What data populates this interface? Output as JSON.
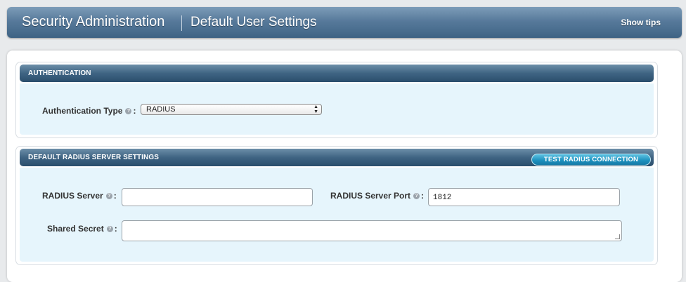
{
  "header": {
    "title": "Security Administration",
    "subtitle": "Default User Settings",
    "show_tips": "Show tips"
  },
  "authentication": {
    "section_title": "AUTHENTICATION",
    "type_label": "Authentication Type",
    "type_value": "RADIUS",
    "help_icon": "question-icon"
  },
  "radius": {
    "section_title": "DEFAULT RADIUS SERVER SETTINGS",
    "test_button": "TEST RADIUS CONNECTION",
    "server_label": "RADIUS Server",
    "server_value": "",
    "port_label": "RADIUS Server Port",
    "port_value": "1812",
    "secret_label": "Shared Secret",
    "secret_value": ""
  },
  "colon": ":"
}
